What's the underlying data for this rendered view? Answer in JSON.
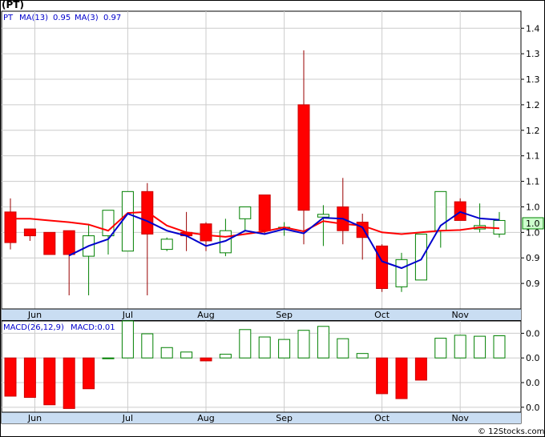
{
  "ticker": "(PT)",
  "legend": {
    "symbol": "PT",
    "ma13_label": "MA(13)",
    "ma13_value": "0.95",
    "ma3_label": "MA(3)",
    "ma3_value": "0.97"
  },
  "macd_legend": {
    "label": "MACD(26,12,9)",
    "value_label": "MACD:0.01"
  },
  "last_price_tag": "1.0",
  "watermark": "© 12Stocks.com",
  "colors": {
    "up": "#008000",
    "down": "#ff0000",
    "ma13": "#ff0000",
    "ma3": "#0000cc",
    "grid": "#cccccc",
    "axis_band": "#c9ddf2",
    "price_tag": "#ccffcc"
  },
  "chart_data": [
    {
      "type": "candlestick",
      "title": "",
      "x_tick_labels": [
        "Jun",
        "Jul",
        "Aug",
        "Sep",
        "Oct",
        "Nov"
      ],
      "x_tick_positions": [
        1.25,
        6,
        10,
        14,
        19,
        23
      ],
      "y_tick_labels": [
        "1.4",
        "1.3",
        "1.3",
        "1.2",
        "1.2",
        "1.1",
        "1.1",
        "1.0",
        "1.0",
        "0.9",
        "0.9"
      ],
      "y_tick_values": [
        1.425,
        1.35,
        1.275,
        1.2,
        1.125,
        1.05,
        0.975,
        0.9,
        0.825,
        0.75,
        0.675
      ],
      "ylim": [
        0.6,
        1.475
      ],
      "grid": true,
      "candles": [
        {
          "x": 0,
          "open": 0.885,
          "high": 0.925,
          "low": 0.775,
          "close": 0.795
        },
        {
          "x": 1,
          "open": 0.835,
          "high": 0.835,
          "low": 0.8,
          "close": 0.815
        },
        {
          "x": 2,
          "open": 0.825,
          "high": 0.825,
          "low": 0.77,
          "close": 0.76
        },
        {
          "x": 3,
          "open": 0.83,
          "high": 0.83,
          "low": 0.64,
          "close": 0.76
        },
        {
          "x": 4,
          "open": 0.755,
          "high": 0.85,
          "low": 0.64,
          "close": 0.815
        },
        {
          "x": 5,
          "open": 0.815,
          "high": 0.89,
          "low": 0.76,
          "close": 0.89
        },
        {
          "x": 6,
          "open": 0.77,
          "high": 0.945,
          "low": 0.77,
          "close": 0.945
        },
        {
          "x": 7,
          "open": 0.945,
          "high": 0.97,
          "low": 0.64,
          "close": 0.82
        },
        {
          "x": 8,
          "open": 0.775,
          "high": 0.81,
          "low": 0.77,
          "close": 0.805
        },
        {
          "x": 9,
          "open": 0.825,
          "high": 0.885,
          "low": 0.77,
          "close": 0.815
        },
        {
          "x": 10,
          "open": 0.85,
          "high": 0.855,
          "low": 0.77,
          "close": 0.8
        },
        {
          "x": 11,
          "open": 0.765,
          "high": 0.865,
          "low": 0.755,
          "close": 0.83
        },
        {
          "x": 12,
          "open": 0.865,
          "high": 0.9,
          "low": 0.83,
          "close": 0.9
        },
        {
          "x": 13,
          "open": 0.935,
          "high": 0.935,
          "low": 0.82,
          "close": 0.83
        },
        {
          "x": 14,
          "open": 0.84,
          "high": 0.855,
          "low": 0.815,
          "close": 0.84
        },
        {
          "x": 15,
          "open": 1.2,
          "high": 1.36,
          "low": 0.79,
          "close": 0.89
        },
        {
          "x": 16,
          "open": 0.87,
          "high": 0.905,
          "low": 0.785,
          "close": 0.878
        },
        {
          "x": 17,
          "open": 0.9,
          "high": 0.985,
          "low": 0.79,
          "close": 0.83
        },
        {
          "x": 18,
          "open": 0.855,
          "high": 0.88,
          "low": 0.745,
          "close": 0.81
        },
        {
          "x": 19,
          "open": 0.785,
          "high": 0.79,
          "low": 0.65,
          "close": 0.66
        },
        {
          "x": 20,
          "open": 0.665,
          "high": 0.765,
          "low": 0.65,
          "close": 0.745
        },
        {
          "x": 21,
          "open": 0.685,
          "high": 0.82,
          "low": 0.685,
          "close": 0.82
        },
        {
          "x": 22,
          "open": 0.83,
          "high": 0.945,
          "low": 0.78,
          "close": 0.945
        },
        {
          "x": 23,
          "open": 0.915,
          "high": 0.925,
          "low": 0.86,
          "close": 0.86
        },
        {
          "x": 24,
          "open": 0.835,
          "high": 0.91,
          "low": 0.825,
          "close": 0.845
        },
        {
          "x": 25,
          "open": 0.82,
          "high": 0.885,
          "low": 0.81,
          "close": 0.86
        }
      ],
      "series": [
        {
          "name": "MA(13)",
          "color": "#ff0000",
          "points": [
            [
              0,
              0.865
            ],
            [
              1,
              0.865
            ],
            [
              2,
              0.86
            ],
            [
              3,
              0.855
            ],
            [
              4,
              0.848
            ],
            [
              5,
              0.83
            ],
            [
              6,
              0.882
            ],
            [
              7,
              0.885
            ],
            [
              8,
              0.845
            ],
            [
              9,
              0.825
            ],
            [
              10,
              0.817
            ],
            [
              11,
              0.812
            ],
            [
              12,
              0.82
            ],
            [
              13,
              0.828
            ],
            [
              14,
              0.84
            ],
            [
              15,
              0.828
            ],
            [
              16,
              0.858
            ],
            [
              17,
              0.85
            ],
            [
              18,
              0.845
            ],
            [
              19,
              0.825
            ],
            [
              20,
              0.82
            ],
            [
              21,
              0.825
            ],
            [
              22,
              0.83
            ],
            [
              23,
              0.832
            ],
            [
              24,
              0.84
            ],
            [
              25,
              0.837
            ]
          ]
        },
        {
          "name": "MA(3)",
          "color": "#0000cc",
          "points": [
            [
              3,
              0.757
            ],
            [
              4,
              0.785
            ],
            [
              5,
              0.805
            ],
            [
              6,
              0.88
            ],
            [
              7,
              0.858
            ],
            [
              8,
              0.83
            ],
            [
              9,
              0.815
            ],
            [
              10,
              0.785
            ],
            [
              11,
              0.8
            ],
            [
              12,
              0.83
            ],
            [
              13,
              0.82
            ],
            [
              14,
              0.835
            ],
            [
              15,
              0.822
            ],
            [
              16,
              0.868
            ],
            [
              17,
              0.865
            ],
            [
              18,
              0.84
            ],
            [
              19,
              0.74
            ],
            [
              20,
              0.72
            ],
            [
              21,
              0.745
            ],
            [
              22,
              0.845
            ],
            [
              23,
              0.885
            ],
            [
              24,
              0.866
            ],
            [
              25,
              0.862
            ]
          ]
        }
      ]
    },
    {
      "type": "bar",
      "title": "MACD(26,12,9)",
      "x_tick_labels": [
        "Jun",
        "Jul",
        "Aug",
        "Sep",
        "Oct",
        "Nov"
      ],
      "y_tick_labels": [
        "0.0",
        "0.0",
        "0.0",
        "0.0"
      ],
      "y_tick_values": [
        0.01,
        0.0,
        -0.01,
        -0.02
      ],
      "ylim": [
        -0.022,
        0.015
      ],
      "grid": true,
      "values": [
        -0.0155,
        -0.016,
        -0.019,
        -0.0205,
        -0.0125,
        0.0,
        0.015,
        0.0098,
        0.0042,
        0.0024,
        -0.0012,
        0.0015,
        0.0115,
        0.0085,
        0.0075,
        0.0112,
        0.0128,
        0.0078,
        0.0018,
        -0.0145,
        -0.0165,
        -0.009,
        0.008,
        0.0092,
        0.0088,
        0.009
      ]
    }
  ]
}
